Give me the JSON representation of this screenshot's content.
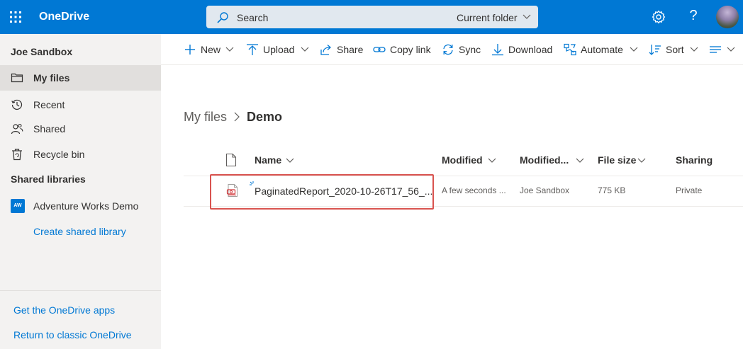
{
  "app": {
    "name": "OneDrive",
    "brand_color": "#0078d4"
  },
  "search": {
    "placeholder": "Search",
    "scope": "Current folder"
  },
  "sidebar": {
    "user": "Joe Sandbox",
    "items": [
      {
        "label": "My files",
        "icon": "folder-icon",
        "selected": true
      },
      {
        "label": "Recent",
        "icon": "history-icon",
        "selected": false
      },
      {
        "label": "Shared",
        "icon": "people-icon",
        "selected": false
      },
      {
        "label": "Recycle bin",
        "icon": "recycle-bin-icon",
        "selected": false
      }
    ],
    "shared_libraries": {
      "title": "Shared libraries",
      "library": {
        "badge": "AW",
        "label": "Adventure Works Demo"
      },
      "create_label": "Create shared library"
    },
    "footer_links": [
      "Get the OneDrive apps",
      "Return to classic OneDrive"
    ]
  },
  "commands": [
    {
      "label": "New",
      "icon": "plus-icon",
      "dropdown": true
    },
    {
      "label": "Upload",
      "icon": "upload-icon",
      "dropdown": true
    },
    {
      "label": "Share",
      "icon": "share-icon",
      "dropdown": false
    },
    {
      "label": "Copy link",
      "icon": "link-icon",
      "dropdown": false
    },
    {
      "label": "Sync",
      "icon": "sync-icon",
      "dropdown": false
    },
    {
      "label": "Download",
      "icon": "download-icon",
      "dropdown": false
    },
    {
      "label": "Automate",
      "icon": "automate-icon",
      "dropdown": true
    },
    {
      "label": "Sort",
      "icon": "sort-icon",
      "dropdown": true
    }
  ],
  "breadcrumb": {
    "root": "My files",
    "current": "Demo"
  },
  "table": {
    "columns": [
      "Name",
      "Modified",
      "Modified...",
      "File size",
      "Sharing"
    ],
    "rows": [
      {
        "name": "PaginatedReport_2020-10-26T17_56_...",
        "modified": "A few seconds ...",
        "modified_by": "Joe Sandbox",
        "file_size": "775 KB",
        "sharing": "Private",
        "icon": "pdf-file-icon",
        "highlighted": true
      }
    ]
  },
  "colors": {
    "accent": "#0078d4",
    "highlight_border": "#d9534f",
    "pdf_red": "#d13438"
  }
}
